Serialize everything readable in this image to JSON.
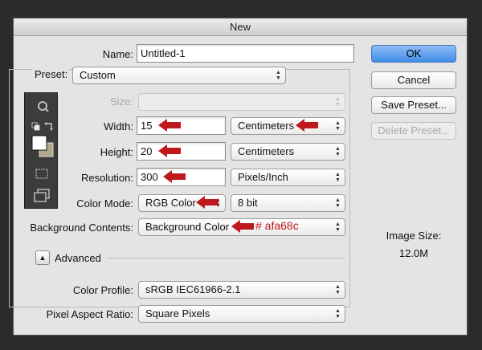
{
  "dialog": {
    "title": "New"
  },
  "name": {
    "label": "Name:",
    "value": "Untitled-1"
  },
  "preset": {
    "label": "Preset:",
    "value": "Custom"
  },
  "size": {
    "label": "Size:",
    "value": ""
  },
  "width": {
    "label": "Width:",
    "value": "15",
    "unit": "Centimeters"
  },
  "height": {
    "label": "Height:",
    "value": "20",
    "unit": "Centimeters"
  },
  "resolution": {
    "label": "Resolution:",
    "value": "300",
    "unit": "Pixels/Inch"
  },
  "color_mode": {
    "label": "Color Mode:",
    "value": "RGB Color",
    "bit_depth": "8 bit"
  },
  "background": {
    "label": "Background Contents:",
    "value": "Background Color",
    "annotation": "# afa68c"
  },
  "advanced": {
    "label": "Advanced"
  },
  "color_profile": {
    "label": "Color Profile:",
    "value": "sRGB IEC61966-2.1"
  },
  "pixel_aspect": {
    "label": "Pixel Aspect Ratio:",
    "value": "Square Pixels"
  },
  "buttons": {
    "ok": "OK",
    "cancel": "Cancel",
    "save_preset": "Save Preset...",
    "delete_preset": "Delete Preset..."
  },
  "image_size": {
    "label": "Image Size:",
    "value": "12.0M"
  },
  "colors": {
    "annotation_red": "#c0191d",
    "background_swatch": "#afa68c",
    "foreground_swatch": "#ffffff",
    "ok_button": "#3f8de8"
  },
  "toolbar_icons": [
    "zoom-icon",
    "default-colors-icon",
    "swap-colors-icon",
    "foreground-swatch",
    "background-swatch",
    "quick-mask-icon",
    "screen-mode-icon"
  ]
}
